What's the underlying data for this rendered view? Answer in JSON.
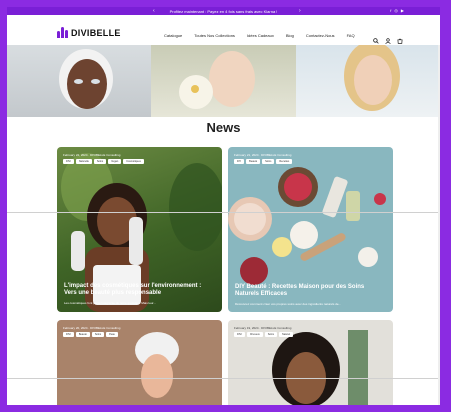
{
  "announcement": {
    "text": "Profitez maintenant : Payez en 4 fois sans frais avec Klarna !",
    "prev": "‹",
    "next": "›",
    "social": [
      "f",
      "◎",
      "▶"
    ]
  },
  "header": {
    "logo": "DIVIBELLE",
    "nav": [
      "Catalogue",
      "Toutes Nos Collections",
      "Idées Cadeaux",
      "Blog",
      "Contactez-Nous",
      "FAQ"
    ],
    "icons": [
      "search-icon",
      "account-icon",
      "cart-icon"
    ]
  },
  "page": {
    "title": "News"
  },
  "cards": [
    {
      "meta": "February 22, 2024 · DIVIBELLE Consulting",
      "tags": [
        "DIVI",
        "Naturelle",
        "Soins",
        "Vegan",
        "Cosmétiques"
      ],
      "title": "L'impact des cosmétiques sur l'environnement : Vers une beauté plus responsable",
      "excerpt": "Les cosmétiques font partie intégrante de notre quotidien. Mais leur..."
    },
    {
      "meta": "February 21, 2024 · DIVIBELLE Consulting",
      "tags": [
        "DIY",
        "Beauté",
        "Soins",
        "Recettes"
      ],
      "title": "DIY Beauté : Recettes Maison pour des Soins Naturels Efficaces",
      "excerpt": "Découvrez comment créer vos propres soins avec des ingrédients naturels de..."
    },
    {
      "meta": "February 20, 2024 · DIVIBELLE Consulting",
      "tags": [
        "DIVI",
        "Beauté",
        "Soins",
        "Peau"
      ]
    },
    {
      "meta": "February 19, 2024 · DIVIBELLE Consulting",
      "tags": [
        "DIVI",
        "Cheveux",
        "Soins",
        "Naturel"
      ]
    }
  ],
  "colors": {
    "brand": "#7a1fd6",
    "frame": "#8b2be2"
  }
}
